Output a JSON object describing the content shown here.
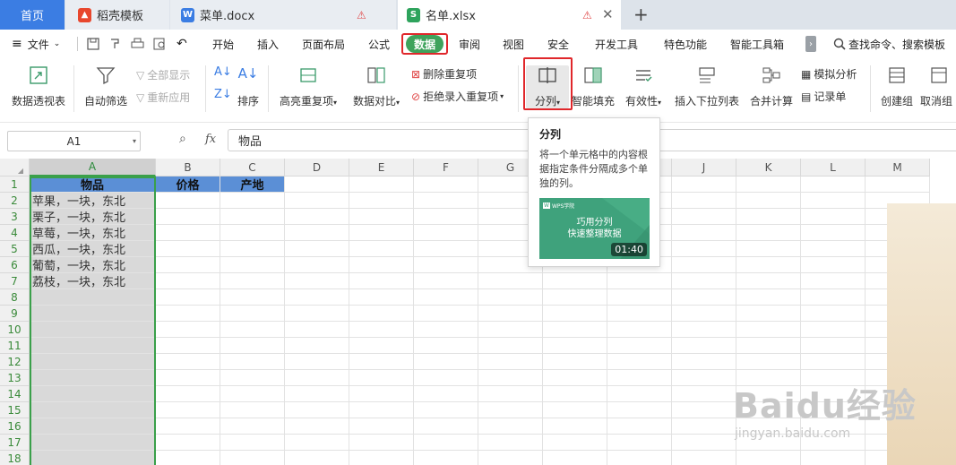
{
  "tabs": {
    "home": "首页",
    "t1": "稻壳模板",
    "t2": "菜单.docx",
    "t3": "名单.xlsx",
    "new_tab": "+"
  },
  "menu": {
    "file": "文件",
    "items": [
      "开始",
      "插入",
      "页面布局",
      "公式",
      "数据",
      "审阅",
      "视图",
      "安全",
      "开发工具",
      "特色功能",
      "智能工具箱"
    ],
    "search": "查找命令、搜索模板"
  },
  "ribbon": {
    "pivot": "数据透视表",
    "auto_filter": "自动筛选",
    "show_all": "全部显示",
    "reapply": "重新应用",
    "sort": "排序",
    "highlight_dup": "高亮重复项",
    "compare": "数据对比",
    "delete_dup": "删除重复项",
    "reject_dup": "拒绝录入重复项",
    "split_col": "分列",
    "smart_fill": "智能填充",
    "validity": "有效性",
    "dropdown": "插入下拉列表",
    "consolidate": "合并计算",
    "simulate": "模拟分析",
    "record": "记录单",
    "create_group": "创建组",
    "ungroup": "取消组"
  },
  "formula_bar": {
    "cell_ref": "A1",
    "fx": "fx",
    "content": "物品"
  },
  "sheet": {
    "columns": [
      "A",
      "B",
      "C",
      "D",
      "E",
      "F",
      "G",
      "H",
      "I",
      "J",
      "K",
      "L",
      "M"
    ],
    "rows": [
      "1",
      "2",
      "3",
      "4",
      "5",
      "6",
      "7",
      "8",
      "9",
      "10",
      "11",
      "12",
      "13",
      "14",
      "15",
      "16",
      "17",
      "18"
    ],
    "header": [
      "物品",
      "价格",
      "产地"
    ],
    "data": [
      "苹果，一块，东北",
      "栗子，一块，东北",
      "草莓，一块，东北",
      "西瓜，一块，东北",
      "葡萄，一块，东北",
      "荔枝，一块，东北"
    ]
  },
  "tooltip": {
    "title": "分列",
    "description": "将一个单元格中的内容根据指定条件分隔成多个单独的列。",
    "video_brand": "WPS学院",
    "video_line1": "巧用分列",
    "video_line2": "快速整理数据",
    "video_duration": "01:40"
  },
  "watermark": {
    "brand": "Baidu经验",
    "url": "jingyan.baidu.com"
  },
  "colors": {
    "accent": "#3b7de3",
    "active_tab": "#3fa35c",
    "header_fill": "#5b8fd6",
    "highlight_red": "#e0272b",
    "select_green": "#3aa04a"
  }
}
